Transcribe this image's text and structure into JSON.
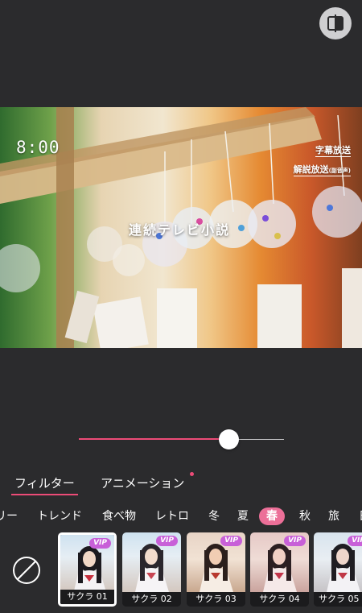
{
  "toolbar": {
    "compare_icon": "split-compare-icon"
  },
  "preview": {
    "clock": "8:00",
    "tag_subtitles": "字幕放送",
    "tag_commentary": "解説放送",
    "tag_commentary_sub": "(副音声)",
    "caption": "連続テレビ小説"
  },
  "slider": {
    "value": 0.73,
    "accent": "#ec4b77"
  },
  "tabs": [
    {
      "label": "フィルター",
      "active": true
    },
    {
      "label": "アニメーション",
      "active": false,
      "has_badge": true
    }
  ],
  "categories": [
    "リー",
    "トレンド",
    "食べ物",
    "レトロ",
    "冬",
    "夏",
    "春",
    "秋",
    "旅",
    "日"
  ],
  "active_category": "春",
  "none_icon": "no-filter-icon",
  "filters": [
    {
      "label": "サクラ 01",
      "vip": "VIP",
      "selected": true
    },
    {
      "label": "サクラ 02",
      "vip": "VIP",
      "selected": false
    },
    {
      "label": "サクラ 03",
      "vip": "VIP",
      "selected": false
    },
    {
      "label": "サクラ 04",
      "vip": "VIP",
      "selected": false
    },
    {
      "label": "サクラ 05",
      "vip": "VIP",
      "selected": false
    }
  ]
}
